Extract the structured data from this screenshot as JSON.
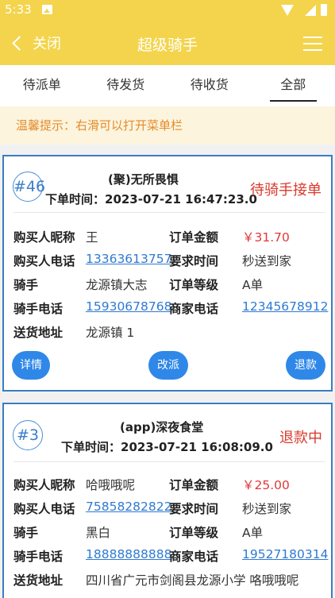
{
  "status_bar": {
    "time": "5:33"
  },
  "app_bar": {
    "back_label": "关闭",
    "title": "超级骑手"
  },
  "tabs": [
    "待派单",
    "待发货",
    "待收货",
    "全部"
  ],
  "active_tab": "全部",
  "tip": "温馨提示：右滑可以打开菜单栏",
  "labels": {
    "buyer_nick": "购买人昵称",
    "buyer_phone": "购买人电话",
    "rider": "骑手",
    "rider_phone": "骑手电话",
    "address": "送货地址",
    "amount": "订单金额",
    "req_time": "要求时间",
    "level": "订单等级",
    "merchant_phone": "商家电话"
  },
  "orders": [
    {
      "number": "#46",
      "shop": "(聚)无所畏惧",
      "order_time": "下单时间：2023-07-21 16:47:23.0",
      "status": "待骑手接单",
      "buyer_nick": "王",
      "buyer_phone": "13363613757",
      "rider": "龙源镇大志",
      "rider_phone": "15930678768",
      "address": "龙源镇 1",
      "amount": "￥31.70",
      "req_time": "秒送到家",
      "level": "A单",
      "merchant_phone": "12345678912",
      "buttons": {
        "detail": "详情",
        "reassign": "改派",
        "refund": "退款"
      }
    },
    {
      "number": "#3",
      "shop": "(app)深夜食堂",
      "order_time": "下单时间：2023-07-21 16:08:09.0",
      "status": "退款中",
      "buyer_nick": "哈哦哦呢",
      "buyer_phone": "75858282822",
      "rider": "黑白",
      "rider_phone": "18888888888",
      "address": "四川省广元市剑阁县龙源小学 咯哦哦呢",
      "amount": "￥25.00",
      "req_time": "秒送到家",
      "level": "A单",
      "merchant_phone": "19527180314"
    }
  ]
}
